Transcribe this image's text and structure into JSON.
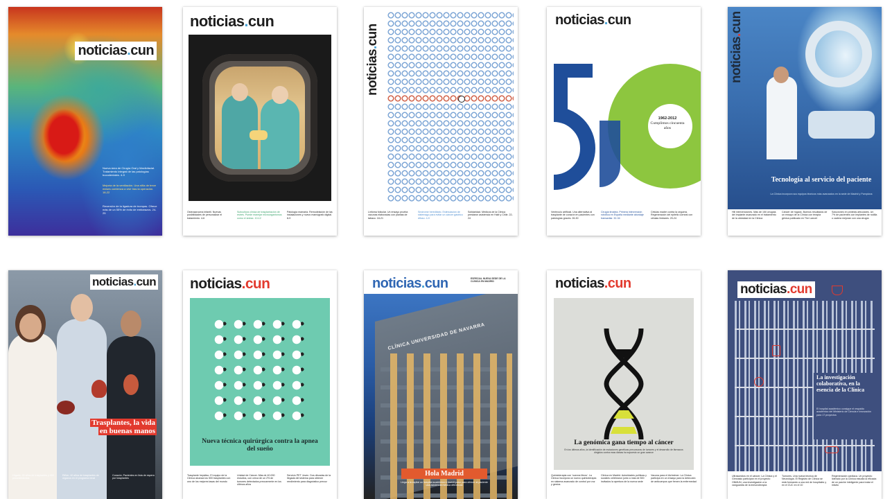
{
  "masthead": {
    "name": "noticias",
    "dot": ".",
    "suffix": "cun"
  },
  "covers": [
    {
      "id": 1,
      "side_notes": [
        "Nueva área de Cirugía Oral y Maxilofacial. Tratamiento integral de las patologías bucodentales. 4-9",
        "Mejoría de la ventilación. Una niña de trece meses comienza a vivir tras la operación. 18-22",
        "Reversión de la ligadura de trompas. Ofrece más de un 55% de éxito de embarazos. 24-25"
      ]
    },
    {
      "id": 2,
      "footer": [
        "Osteosarcoma infantil. Nuevas posibilidades de personalizar el tratamiento. 4-6",
        "Subcultura clínica de trasplantación de estrés. Puede manejar microorganismos como el ántrax. 10-12",
        "Patología mamaria. Remodelación de las instalaciones y nuevo mamógrafo digital. 8-9"
      ]
    },
    {
      "id": 3,
      "footer": [
        "Linfoma folicular. Un ensayo prueba vacunas elaboradas con plantas de tabaco. 18-21",
        "Síndrome hereditario. Estimulación de sistemago para evitar un cáncer gástrico difuso. 4-9",
        "Solidaridad. Médicos de la Clínica prestaron asistencia en Haití y Chile. 22-24"
      ]
    },
    {
      "id": 4,
      "anniversary_years": "1962-2012",
      "anniversary_text": "Cumplimos cincuenta años",
      "big_number": "50",
      "footer": [
        "Ventrículo artificial. Una alternativa al trasplante de corazón en pacientes con patologías graves. 26-30",
        "Cirugía tiroidea. Primera intervención robótica en España mediante abordaje transaxilar. 32-34",
        "Células madre contra la ceguera. Regeneración del epitelio corneal con células limbares. 20-24"
      ]
    },
    {
      "id": 5,
      "headline": "Tecnología al servicio del paciente",
      "subline": "La Clínica incorpora sus equipos técnicos más avanzados en la sede de Madrid y Pamplona",
      "footer": [
        "Hill intervenciones. Más de 150 cirugías del implante avanzado en el tratamiento de la obesidad en la Clínica",
        "Cáncer de hígado. Buenos resultados de un ensayo de la Clínica con terapia génica publicado en The Lancet",
        "Soluciones en prótesis articulares. Un 7% de pacientes con implantes de rodilla o cadera mejoran con una cirugía"
      ]
    },
    {
      "id": 6,
      "headline": "Trasplantes, la vida en buenas manos",
      "footer": [
        "Hígado. 30 años de trasplantes y 400 procedimientos",
        "Riñón. 40 años de trasplantes de órganos en el programa renal",
        "Corazón. Pacientes en lista de espera por trasplantes"
      ]
    },
    {
      "id": 7,
      "headline": "Nueva técnica quirúrgica contra la apnea del sueño",
      "footer": [
        "Trasplante hepático. El equipo de la Clínica alcanza los 500 trasplantes con uno de los mejores tasas del mundo",
        "Unidad de Cáncer. Más de 40.000 estudios, con cerca de un 2% de tumores detectados precozmente en los últimos años",
        "Servicio PET Joven. Dos décadas de la llegada del sistema para obtener rendimiento para diagnóstico precoz"
      ]
    },
    {
      "id": 8,
      "facade_text": "CLÍNICA UNIVERSIDAD DE NAVARRA",
      "banner_title": "Hola Madrid",
      "banner_text": "Llega a la capital un hospital académico e investigador para ofrecer al paciente una asistencia médica diferencial",
      "top_right": "ESPECIAL NUEVA SEDE DE LA CLÍNICA EN MADRID"
    },
    {
      "id": 9,
      "headline": "La genómica gana tiempo al cáncer",
      "subline": "En los últimos años, la identificación de mutaciones genéticas precursoras de tumores y el desarrollo de fármacos dirigidos contra esas dianas ha supuesto un gran avance",
      "footer": [
        "Quimioterapia con 'nuevos libros'. La Clínica incorpora un nuevo quimioterapia en sistema avanzado de control por voz y gestos",
        "Clínica en Madrid. Autoridades políticas y sociales celebraron junto a más de 500 invitados la apertura de la nueva sede",
        "Vacuna para el Alzheimer. La Clínica participa en un ensayo para la detección de anticuerpos que frenen la enfermedad"
      ]
    },
    {
      "id": 10,
      "headline": "La investigación colaborativa, en la esencia de la Clínica",
      "subline": "El hospital académico consigue el respaldo académico del Ministerio de Ciencia e Innovación para 17 proyectos",
      "footer": [
        "Ultrasonidos en el cáncer. La Clínica y el Gimnasio participan en el proyecto ONMUN, una investigación a la vanguardia de la inmunoterapia",
        "Tumores. Una nueva técnica de Neurología. El Registro de Clínica se está formando a una red de hospitales y en el CUC en el 10",
        "Regeneración cardiaca. Un proyecto liderado por la Clínica estudia la eficacia de un parche inteligente para tratar el infarto"
      ]
    }
  ]
}
